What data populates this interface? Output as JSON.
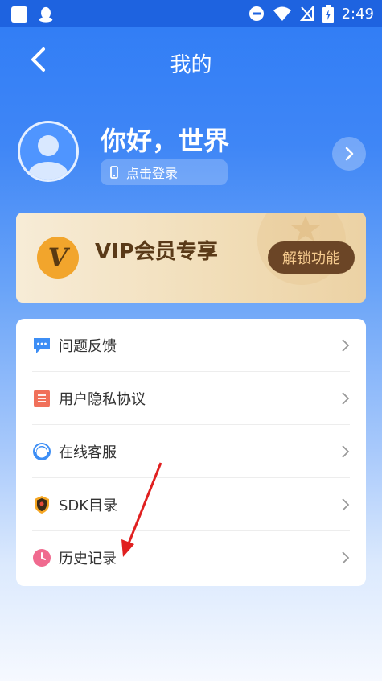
{
  "status_bar": {
    "time": "2:49"
  },
  "header": {
    "title": "我的"
  },
  "profile": {
    "greeting": "你好，世界",
    "login_label": "点击登录"
  },
  "vip": {
    "badge": "V",
    "title": "VIP会员专享",
    "unlock_label": "解锁功能"
  },
  "menu": {
    "items": [
      {
        "label": "问题反馈",
        "icon": "feedback-icon"
      },
      {
        "label": "用户隐私协议",
        "icon": "document-icon"
      },
      {
        "label": "在线客服",
        "icon": "customer-service-icon"
      },
      {
        "label": "SDK目录",
        "icon": "shield-icon"
      },
      {
        "label": "历史记录",
        "icon": "clock-icon"
      }
    ]
  },
  "colors": {
    "primary": "#2f7cf5",
    "vip_button": "#6b4526",
    "vip_text": "#5a3a18"
  }
}
